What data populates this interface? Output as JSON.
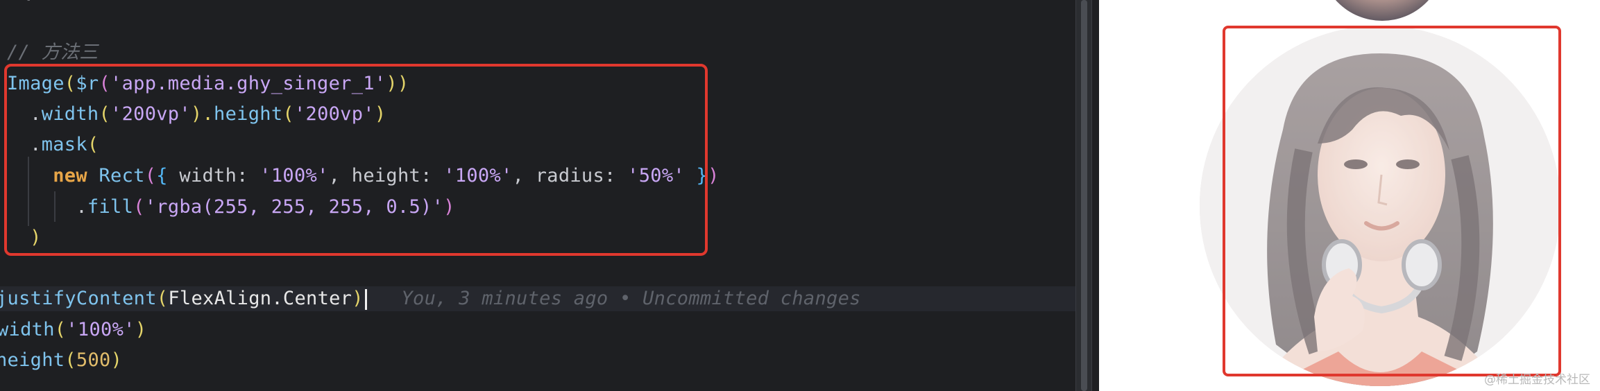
{
  "editor": {
    "lines": {
      "comment": "// 方法三",
      "l1_fn": "Image",
      "l1_a": "(",
      "l1_b": "$r",
      "l1_c": "(",
      "l1_str": "'app.media.ghy_singer_1'",
      "l1_d": "))",
      "l2_a": ".",
      "l2_fn": "width",
      "l2_b": "(",
      "l2_str": "'200vp'",
      "l2_c": ").",
      "l2_fn2": "height",
      "l2_d": "(",
      "l2_str2": "'200vp'",
      "l2_e": ")",
      "l3_a": ".",
      "l3_fn": "mask",
      "l3_b": "(",
      "l4_kw": "new",
      "l4_cls": "Rect",
      "l4_a": "(",
      "l4_b": "{",
      "l4_k1": "width",
      "l4_c1": ": ",
      "l4_s1": "'100%'",
      "l4_sep1": ", ",
      "l4_k2": "height",
      "l4_c2": ": ",
      "l4_s2": "'100%'",
      "l4_sep2": ", ",
      "l4_k3": "radius",
      "l4_c3": ": ",
      "l4_s3": "'50%'",
      "l4_d": "}",
      "l4_e": ")",
      "l5_a": ".",
      "l5_fn": "fill",
      "l5_b": "(",
      "l5_str": "'rgba(255, 255, 255, 0.5)'",
      "l5_c": ")",
      "l6_a": ")",
      "l7_fn": "justifyContent",
      "l7_a": "(",
      "l7_cls": "FlexAlign.Center",
      "l7_b": ")",
      "l7_blame": "You, 3 minutes ago • Uncommitted changes",
      "l8_fn": "width",
      "l8_a": "(",
      "l8_str": "'100%'",
      "l8_b": ")",
      "l9_fn": "height",
      "l9_a": "(",
      "l9_num": "500",
      "l9_b": ")"
    }
  },
  "preview": {
    "image_name": "singer-portrait-image",
    "watermark": "@稀土掘金技术社区"
  },
  "colors": {
    "highlight": "#e0382e",
    "editor_bg": "#1e1f22",
    "preview_bg": "#ffffff"
  }
}
